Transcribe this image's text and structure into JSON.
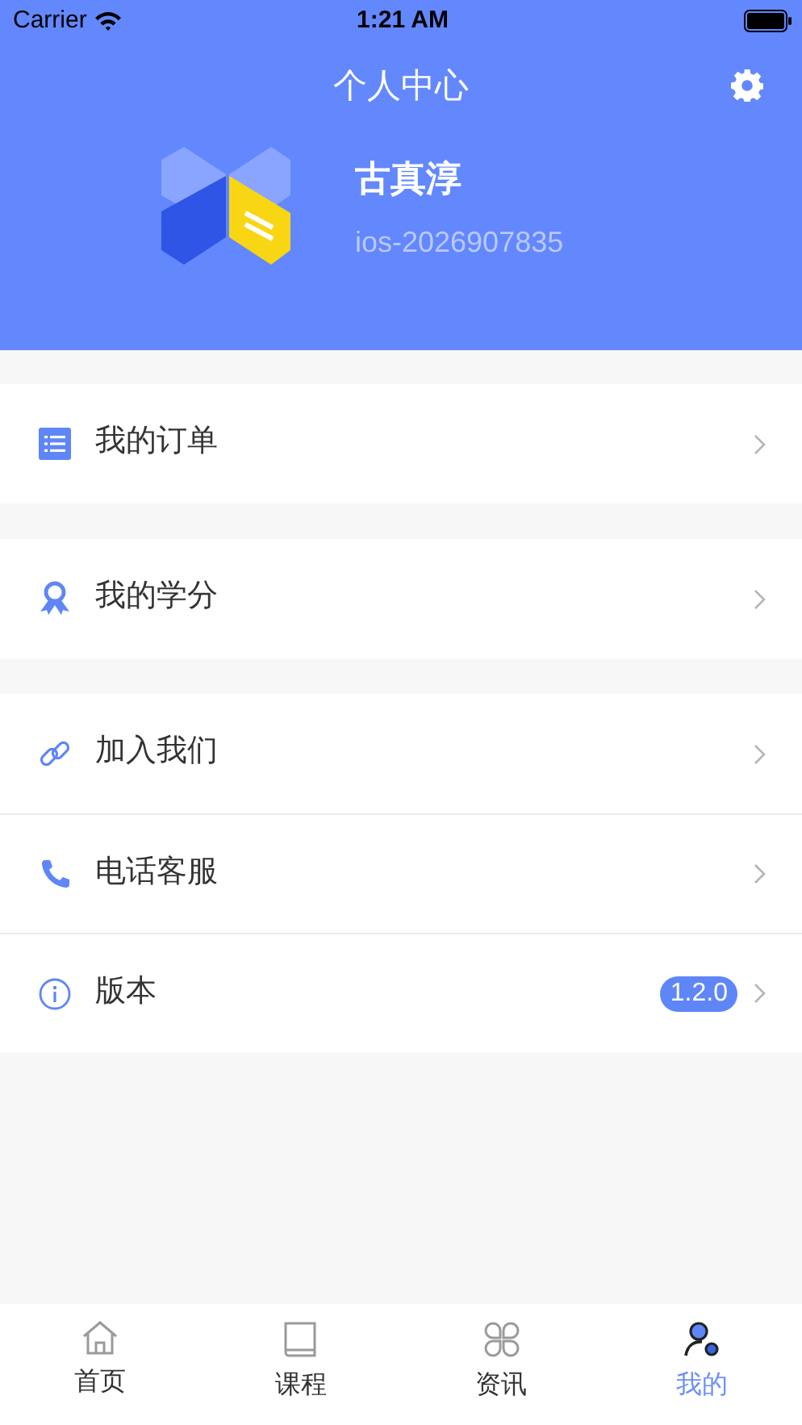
{
  "status_bar": {
    "carrier": "Carrier",
    "time": "1:21 AM"
  },
  "header": {
    "title": "个人中心",
    "name": "古真淳",
    "account": "ios-2026907835"
  },
  "menu_groups": [
    {
      "items": [
        {
          "kind": "orders",
          "label": "我的订单"
        }
      ]
    },
    {
      "items": [
        {
          "kind": "credits",
          "label": "我的学分"
        }
      ]
    },
    {
      "items": [
        {
          "kind": "join",
          "label": "加入我们"
        },
        {
          "kind": "phone",
          "label": "电话客服"
        },
        {
          "kind": "version",
          "label": "版本",
          "badge": "1.2.0"
        }
      ]
    }
  ],
  "tabs": [
    {
      "kind": "home",
      "label": "首页",
      "selected": false
    },
    {
      "kind": "courses",
      "label": "课程",
      "selected": false
    },
    {
      "kind": "news",
      "label": "资讯",
      "selected": false
    },
    {
      "kind": "me",
      "label": "我的",
      "selected": true
    }
  ]
}
